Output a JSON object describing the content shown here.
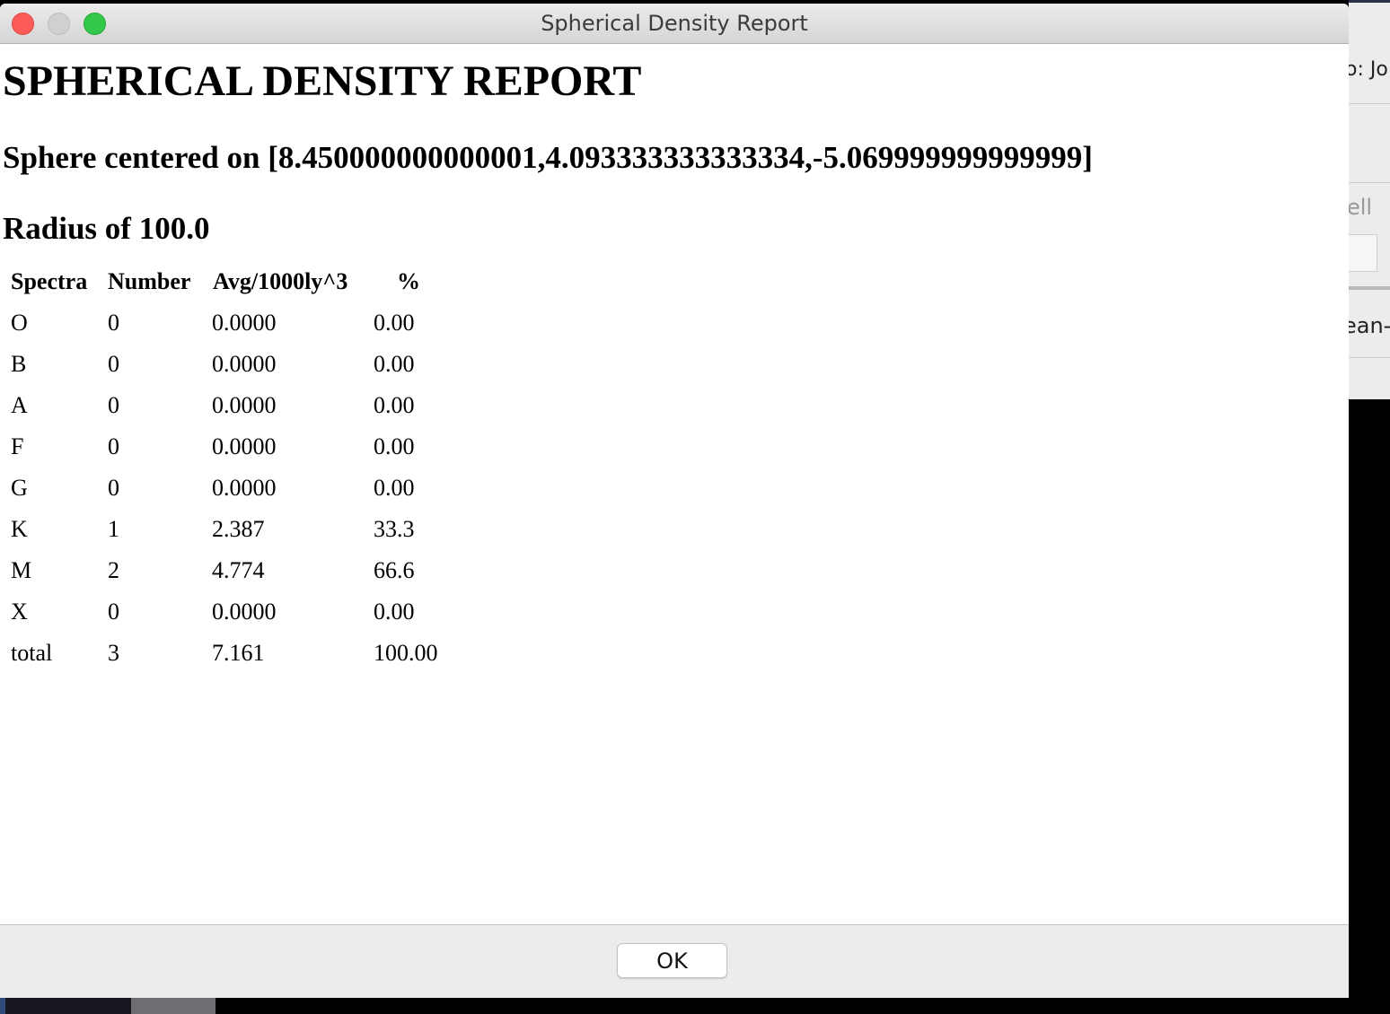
{
  "window": {
    "title": "Spherical Density Report"
  },
  "report": {
    "heading": "SPHERICAL DENSITY REPORT",
    "center_text": "Sphere centered on [8.450000000000001,4.093333333333334,-5.069999999999999]",
    "radius_text": "Radius of 100.0"
  },
  "table": {
    "headers": {
      "spectra": "Spectra",
      "number": "Number",
      "avg": "Avg/1000ly^3",
      "percent": "%"
    },
    "rows": [
      {
        "spectra": "O",
        "number": "0",
        "avg": "0.0000",
        "percent": "0.00"
      },
      {
        "spectra": "B",
        "number": "0",
        "avg": "0.0000",
        "percent": "0.00"
      },
      {
        "spectra": "A",
        "number": "0",
        "avg": "0.0000",
        "percent": "0.00"
      },
      {
        "spectra": "F",
        "number": "0",
        "avg": "0.0000",
        "percent": "0.00"
      },
      {
        "spectra": "G",
        "number": "0",
        "avg": "0.0000",
        "percent": "0.00"
      },
      {
        "spectra": "K",
        "number": "1",
        "avg": "2.387",
        "percent": "33.3"
      },
      {
        "spectra": "M",
        "number": "2",
        "avg": "4.774",
        "percent": "66.6"
      },
      {
        "spectra": "X",
        "number": "0",
        "avg": "0.0000",
        "percent": "0.00"
      },
      {
        "spectra": "total",
        "number": "3",
        "avg": "7.161",
        "percent": "100.00"
      }
    ]
  },
  "footer": {
    "ok_label": "OK"
  },
  "background_app": {
    "fragments": [
      "o:  Jo",
      "ell",
      "ean-c"
    ]
  },
  "colors": {
    "close": "#fc5b57",
    "minimize": "#d0d0d0",
    "zoom": "#34c84a"
  }
}
